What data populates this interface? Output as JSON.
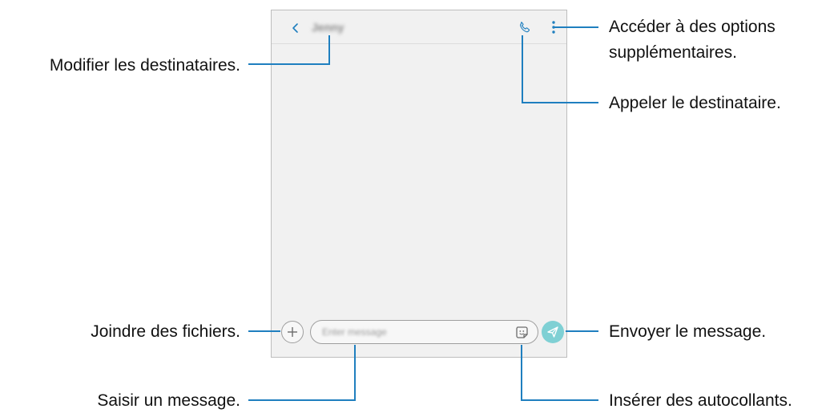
{
  "conversation": {
    "contact_name": "Jenny",
    "message_placeholder": "Enter message"
  },
  "annotations": {
    "edit_recipients": "Modifier les destinataires.",
    "more_options_line1": "Accéder à des options",
    "more_options_line2": "supplémentaires.",
    "call_recipient": "Appeler le destinataire.",
    "attach_files": "Joindre des fichiers.",
    "enter_message": "Saisir un message.",
    "send_message": "Envoyer le message.",
    "insert_stickers": "Insérer des autocollants."
  },
  "colors": {
    "accent_blue": "#1f7fbf",
    "send_teal": "#7fd0d4",
    "screen_background": "#f1f1f1"
  },
  "icons": [
    "back-arrow-icon",
    "phone-icon",
    "more-options-icon",
    "plus-icon",
    "sticker-icon",
    "send-icon"
  ]
}
